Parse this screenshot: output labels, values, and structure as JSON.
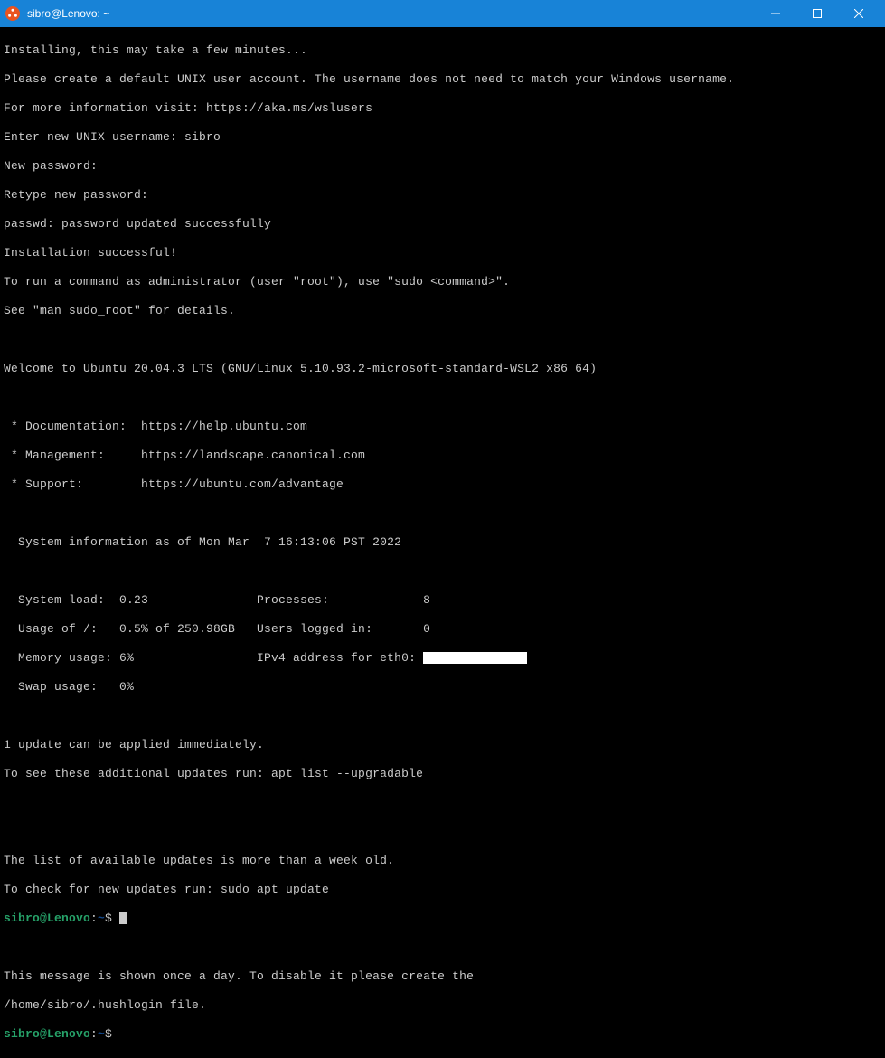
{
  "window": {
    "title": "sibro@Lenovo: ~"
  },
  "lines": {
    "l0": "Installing, this may take a few minutes...",
    "l1": "Please create a default UNIX user account. The username does not need to match your Windows username.",
    "l2": "For more information visit: https://aka.ms/wslusers",
    "l3": "Enter new UNIX username: sibro",
    "l4": "New password:",
    "l5": "Retype new password:",
    "l6": "passwd: password updated successfully",
    "l7": "Installation successful!",
    "l8": "To run a command as administrator (user \"root\"), use \"sudo <command>\".",
    "l9": "See \"man sudo_root\" for details.",
    "l10": "",
    "l11": "Welcome to Ubuntu 20.04.3 LTS (GNU/Linux 5.10.93.2-microsoft-standard-WSL2 x86_64)",
    "l12": "",
    "l13": " * Documentation:  https://help.ubuntu.com",
    "l14": " * Management:     https://landscape.canonical.com",
    "l15": " * Support:        https://ubuntu.com/advantage",
    "l16": "",
    "l17": "  System information as of Mon Mar  7 16:13:06 PST 2022",
    "l18": "",
    "l19": "  System load:  0.23               Processes:             8",
    "l20": "  Usage of /:   0.5% of 250.98GB   Users logged in:       0",
    "l21a": "  Memory usage: 6%                 IPv4 address for eth0: ",
    "l22": "  Swap usage:   0%",
    "l23": "",
    "l24": "1 update can be applied immediately.",
    "l25": "To see these additional updates run: apt list --upgradable",
    "l26": "",
    "l27": "",
    "l28": "The list of available updates is more than a week old.",
    "l29": "To check for new updates run: sudo apt update",
    "l31": "",
    "l32": "This message is shown once a day. To disable it please create the",
    "l33": "/home/sibro/.hushlogin file."
  },
  "prompt": {
    "user": "sibro@Lenovo",
    "colon": ":",
    "path": "~",
    "dollar": "$ "
  }
}
